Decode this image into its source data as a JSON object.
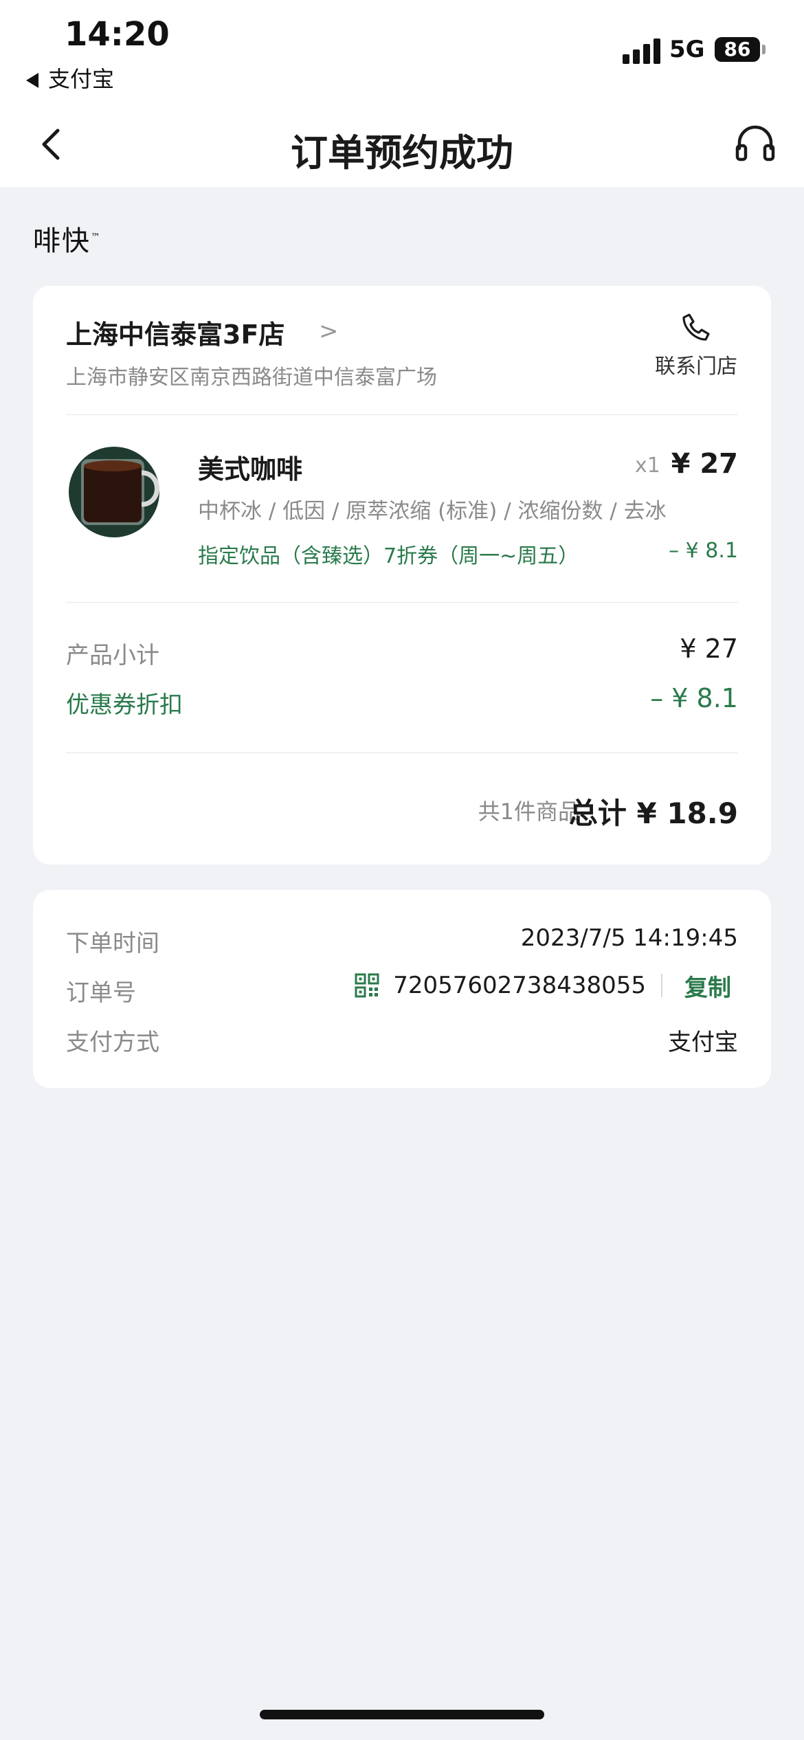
{
  "status_bar": {
    "time": "14:20",
    "back_app": "支付宝",
    "network": "5G",
    "battery": "86"
  },
  "nav": {
    "title": "订单预约成功",
    "back_icon": "chevron-left-icon",
    "support_icon": "headset-icon"
  },
  "brand": {
    "name": "啡快"
  },
  "store": {
    "name": "上海中信泰富3F店",
    "address": "上海市静安区南京西路街道中信泰富广场",
    "contact_label": "联系门店",
    "contact_icon": "phone-icon"
  },
  "product": {
    "name": "美式咖啡",
    "quantity": "x1",
    "price": "¥ 27",
    "spec": "中杯冰 / 低因 / 原萃浓缩 (标准) / 浓缩份数 / 去冰",
    "coupon_name": "指定饮品（含臻选）7折券（周一~周五）",
    "coupon_value": "– ¥ 8.1"
  },
  "summary": {
    "subtotal_label": "产品小计",
    "subtotal_value": "¥ 27",
    "discount_label": "优惠券折扣",
    "discount_value": "– ¥ 8.1",
    "count_text": "共1件商品",
    "total_text": "总计 ¥ 18.9"
  },
  "order_info": {
    "time_label": "下单时间",
    "time_value": "2023/7/5 14:19:45",
    "order_no_label": "订单号",
    "order_no_value": "72057602738438055",
    "copy_label": "复制",
    "payment_label": "支付方式",
    "payment_value": "支付宝"
  },
  "colors": {
    "accent_green": "#2a7a4b",
    "background": "#f1f2f5"
  }
}
